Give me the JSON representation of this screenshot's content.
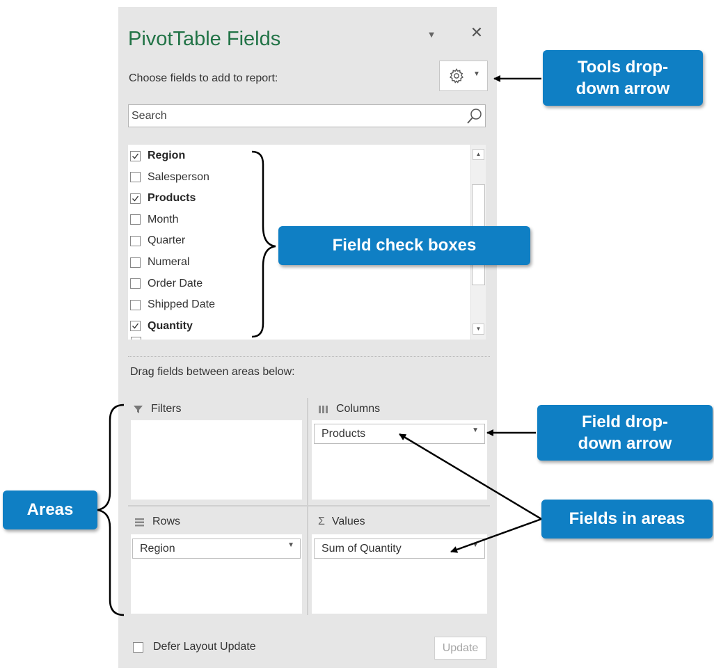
{
  "panel": {
    "title": "PivotTable Fields",
    "subtitle": "Choose fields to add to report:",
    "close_glyph": "✕",
    "title_dropdown_glyph": "▼",
    "tools_button": {
      "icon": "gear-icon",
      "dropdown_glyph": "▼"
    },
    "search": {
      "placeholder": "Search",
      "icon": "search-icon"
    },
    "fields": [
      {
        "label": "Region",
        "checked": true
      },
      {
        "label": "Salesperson",
        "checked": false
      },
      {
        "label": "Products",
        "checked": true
      },
      {
        "label": "Month",
        "checked": false
      },
      {
        "label": "Quarter",
        "checked": false
      },
      {
        "label": "Numeral",
        "checked": false
      },
      {
        "label": "Order Date",
        "checked": false
      },
      {
        "label": "Shipped Date",
        "checked": false
      },
      {
        "label": "Quantity",
        "checked": true
      }
    ],
    "drag_label": "Drag fields between areas below:",
    "areas": {
      "filters": {
        "label": "Filters",
        "icon": "filter-icon",
        "fields": []
      },
      "columns": {
        "label": "Columns",
        "icon": "columns-icon",
        "fields": [
          "Products"
        ]
      },
      "rows": {
        "label": "Rows",
        "icon": "rows-icon",
        "fields": [
          "Region"
        ]
      },
      "values": {
        "label": "Values",
        "icon": "sigma-icon",
        "icon_glyph": "Σ",
        "fields": [
          "Sum of Quantity"
        ]
      }
    },
    "defer_label": "Defer Layout Update",
    "defer_checked": false,
    "update_label": "Update"
  },
  "callouts": {
    "tools": "Tools drop-down arrow",
    "field_checkboxes": "Field check boxes",
    "field_dropdown": "Field drop-down arrow",
    "areas": "Areas",
    "fields_in_areas": "Fields in areas"
  },
  "colors": {
    "accent": "#217346",
    "pane": "#e6e6e6",
    "callout": "#0f7fc4"
  }
}
